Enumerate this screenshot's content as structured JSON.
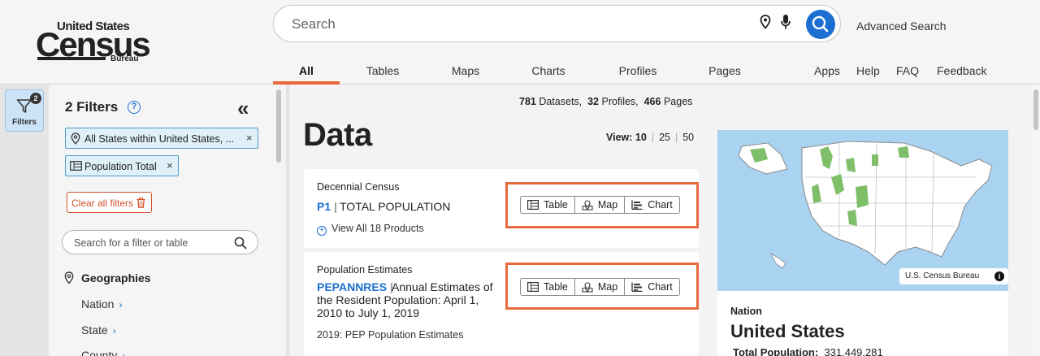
{
  "logo": {
    "line1": "United States",
    "line2": "Census",
    "line3": "Bureau"
  },
  "search": {
    "placeholder": "Search",
    "advanced_label": "Advanced Search"
  },
  "tabs": [
    {
      "label": "All",
      "active": true
    },
    {
      "label": "Tables"
    },
    {
      "label": "Maps"
    },
    {
      "label": "Charts"
    },
    {
      "label": "Profiles"
    },
    {
      "label": "Pages"
    }
  ],
  "top_links": [
    "Apps",
    "Help",
    "FAQ",
    "Feedback"
  ],
  "rail": {
    "filters_label": "Filters",
    "badge_count": "2"
  },
  "filters": {
    "title": "2 Filters",
    "chips": [
      {
        "label": "All States within United States, ...",
        "icon": "location-pin-icon"
      },
      {
        "label": "Population Total",
        "icon": "table-icon"
      }
    ],
    "clear_label": "Clear all filters",
    "search_placeholder": "Search for a filter or table",
    "geographies": {
      "title": "Geographies",
      "items": [
        "Nation",
        "State",
        "County"
      ]
    }
  },
  "results": {
    "datasets_count": "781",
    "datasets_label": "Datasets,",
    "profiles_count": "32",
    "profiles_label": "Profiles,",
    "pages_count": "466",
    "pages_label": "Pages",
    "heading": "Data",
    "view_label": "View:",
    "view_options": [
      "10",
      "25",
      "50"
    ],
    "view_selected": "10"
  },
  "cards": [
    {
      "source": "Decennial Census",
      "code": "P1",
      "name": "TOTAL POPULATION",
      "sub": "View All 18 Products",
      "buttons": [
        "Table",
        "Map",
        "Chart"
      ]
    },
    {
      "source": "Population Estimates",
      "code": "PEPANNRES",
      "name_lines": [
        "Annual Estimates of",
        "the Resident Population: April 1,",
        "2010 to July 1, 2019"
      ],
      "sub": "2019: PEP Population Estimates",
      "buttons": [
        "Table",
        "Map",
        "Chart"
      ]
    }
  ],
  "map_panel": {
    "credit": "U.S. Census Bureau",
    "level_label": "Nation",
    "place_name": "United States",
    "total_label": "Total Population:",
    "total_value": "331,449,281"
  }
}
